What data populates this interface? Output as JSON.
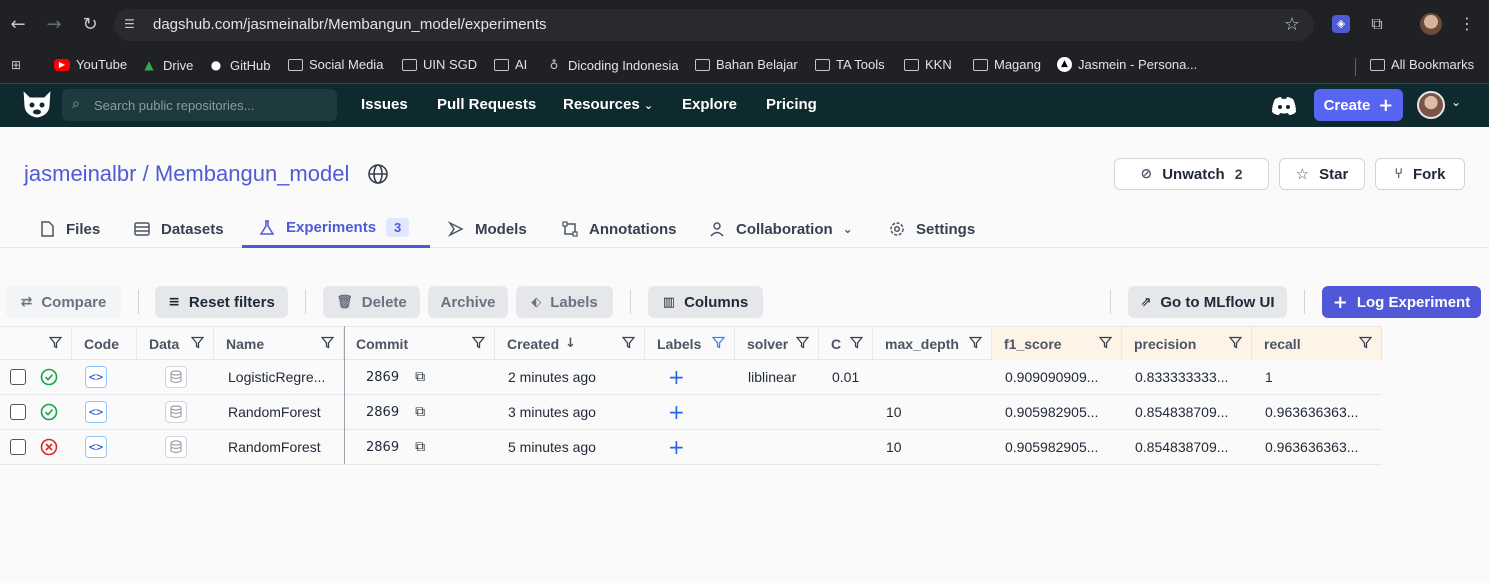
{
  "browser": {
    "url": "dagshub.com/jasmeinalbr/Membangun_model/experiments",
    "bookmarks": [
      "YouTube",
      "Drive",
      "GitHub",
      "Social Media",
      "UIN SGD",
      "AI",
      "Dicoding Indonesia",
      "Bahan Belajar",
      "TA Tools",
      "KKN",
      "Magang",
      "Jasmein - Persona...",
      "All Bookmarks"
    ]
  },
  "header": {
    "search_placeholder": "Search public repositories...",
    "nav": [
      "Issues",
      "Pull Requests",
      "Resources",
      "Explore",
      "Pricing"
    ],
    "create_label": "Create",
    "colors": {
      "bg": "#0f2a2e",
      "accent": "#5865f2"
    }
  },
  "repo": {
    "owner": "jasmeinalbr",
    "separator": "/",
    "name": "Membangun_model",
    "unwatch_label": "Unwatch",
    "watch_count": "2",
    "star_label": "Star",
    "fork_label": "Fork"
  },
  "tabs": [
    {
      "label": "Files"
    },
    {
      "label": "Datasets"
    },
    {
      "label": "Experiments",
      "badge": "3"
    },
    {
      "label": "Models"
    },
    {
      "label": "Annotations"
    },
    {
      "label": "Collaboration"
    },
    {
      "label": "Settings"
    }
  ],
  "toolbar": {
    "compare": "Compare",
    "reset_filters": "Reset filters",
    "delete": "Delete",
    "archive": "Archive",
    "labels": "Labels",
    "columns": "Columns",
    "mlflow": "Go to MLflow UI",
    "log_experiment": "Log Experiment"
  },
  "table": {
    "columns": [
      "Code",
      "Data",
      "Name",
      "Commit",
      "Created",
      "Labels",
      "solver",
      "C",
      "max_depth",
      "f1_score",
      "precision",
      "recall"
    ],
    "rows": [
      {
        "status": "success",
        "name": "LogisticRegre...",
        "commit": "2869",
        "created": "2 minutes ago",
        "solver": "liblinear",
        "C": "0.01",
        "max_depth": "",
        "f1_score": "0.909090909...",
        "precision": "0.833333333...",
        "recall": "1"
      },
      {
        "status": "success",
        "name": "RandomForest",
        "commit": "2869",
        "created": "3 minutes ago",
        "solver": "",
        "C": "",
        "max_depth": "10",
        "f1_score": "0.905982905...",
        "precision": "0.854838709...",
        "recall": "0.963636363..."
      },
      {
        "status": "failed",
        "name": "RandomForest",
        "commit": "2869",
        "created": "5 minutes ago",
        "solver": "",
        "C": "",
        "max_depth": "10",
        "f1_score": "0.905982905...",
        "precision": "0.854838709...",
        "recall": "0.963636363..."
      }
    ]
  }
}
